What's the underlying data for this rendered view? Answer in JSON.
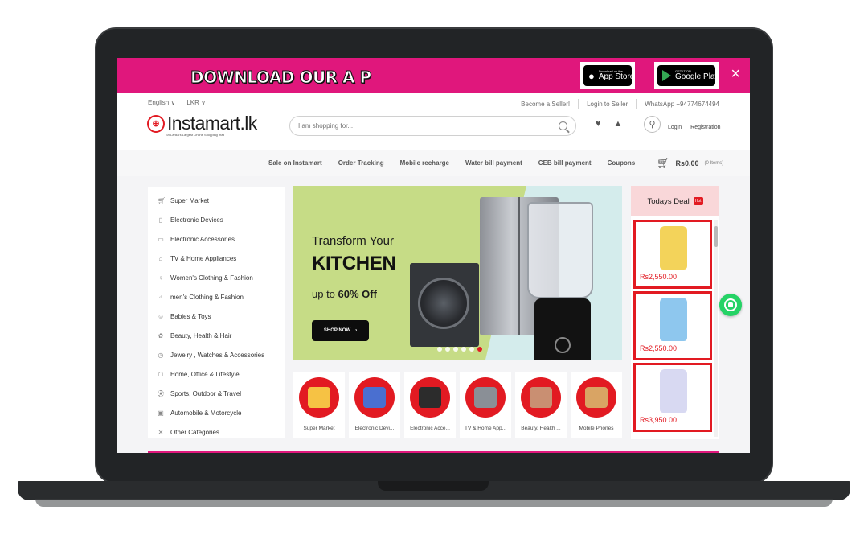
{
  "banner": {
    "text": "DOWNLOAD OUR A P",
    "app_store": {
      "small": "Download on the",
      "big": "App Store"
    },
    "google_play": {
      "small": "GET IT ON",
      "big": "Google Play"
    },
    "close": "×"
  },
  "utility": {
    "language": "English ∨",
    "currency": "LKR ∨",
    "become_seller": "Become a Seller!",
    "login_seller": "Login to Seller",
    "whatsapp": "WhatsApp +94774674494"
  },
  "logo": {
    "name": "Instamart.lk",
    "tagline": "Sri Lanka's Largest Online Shopping mall"
  },
  "search": {
    "placeholder": "I am shopping for..."
  },
  "auth": {
    "login": "Login",
    "register": "Registration"
  },
  "nav": [
    "Sale on Instamart",
    "Order Tracking",
    "Mobile recharge",
    "Water bill payment",
    "CEB bill payment",
    "Coupons"
  ],
  "cart": {
    "total": "Rs0.00",
    "items": "(0 Items)"
  },
  "categories": [
    {
      "label": "Super Market",
      "icon": "cart-icon"
    },
    {
      "label": "Electronic Devices",
      "icon": "phone-icon"
    },
    {
      "label": "Electronic Accessories",
      "icon": "monitor-icon"
    },
    {
      "label": "TV & Home Appliances",
      "icon": "appliance-icon"
    },
    {
      "label": "Women's Clothing & Fashion",
      "icon": "dress-icon"
    },
    {
      "label": "men's Clothing & Fashion",
      "icon": "shirt-icon"
    },
    {
      "label": "Babies & Toys",
      "icon": "baby-icon"
    },
    {
      "label": "Beauty, Health & Hair",
      "icon": "beauty-icon"
    },
    {
      "label": "Jewelry , Watches & Accessories",
      "icon": "watch-icon"
    },
    {
      "label": "Home, Office & Lifestyle",
      "icon": "lamp-icon"
    },
    {
      "label": "Sports, Outdoor & Travel",
      "icon": "sports-icon"
    },
    {
      "label": "Automobile & Motorcycle",
      "icon": "car-icon"
    },
    {
      "label": "Other Categories",
      "icon": "tools-icon"
    }
  ],
  "hero": {
    "line1": "Transform Your",
    "line2": "KITCHEN",
    "line3_pre": "up to ",
    "line3_bold": "60% Off",
    "button": "SHOP NOW",
    "slides": 6,
    "active_slide": 6
  },
  "tiles": [
    {
      "label": "Super Market",
      "color": "#f6c244"
    },
    {
      "label": "Electronic Devi...",
      "color": "#4a6fd0"
    },
    {
      "label": "Electronic Acce...",
      "color": "#2c2c2c"
    },
    {
      "label": "TV & Home App...",
      "color": "#8a8f96"
    },
    {
      "label": "Beauty, Health ...",
      "color": "#c98f72"
    },
    {
      "label": "Mobile Phones",
      "color": "#d9a464"
    }
  ],
  "deal": {
    "title": "Todays Deal",
    "badge": "Hot",
    "items": [
      {
        "price": "Rs2,550.00",
        "color": "#f3d35a"
      },
      {
        "price": "Rs2,550.00",
        "color": "#8ec7ee"
      },
      {
        "price": "Rs3,950.00",
        "color": "#d8d9f2"
      }
    ]
  },
  "colors": {
    "brand_pink": "#e0177c",
    "accent_red": "#e21a22",
    "whatsapp_green": "#25d366"
  }
}
